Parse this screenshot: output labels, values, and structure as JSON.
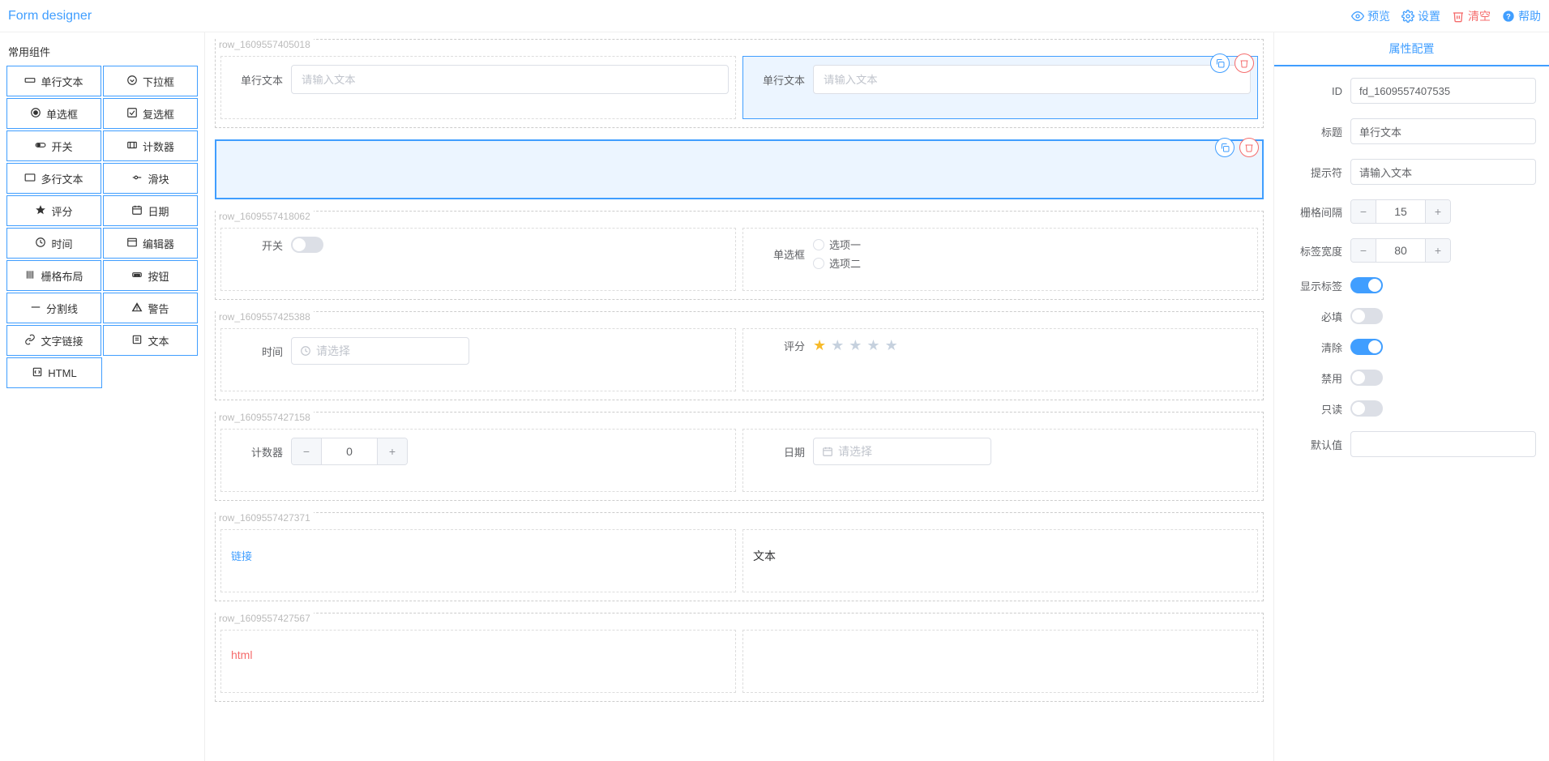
{
  "header": {
    "title": "Form designer",
    "actions": {
      "preview": "预览",
      "settings": "设置",
      "clear": "清空",
      "help": "帮助"
    }
  },
  "sidebar": {
    "title": "常用组件",
    "items": [
      {
        "key": "input",
        "label": "单行文本"
      },
      {
        "key": "select",
        "label": "下拉框"
      },
      {
        "key": "radio",
        "label": "单选框"
      },
      {
        "key": "checkbox",
        "label": "复选框"
      },
      {
        "key": "switch",
        "label": "开关"
      },
      {
        "key": "number",
        "label": "计数器"
      },
      {
        "key": "textarea",
        "label": "多行文本"
      },
      {
        "key": "slider",
        "label": "滑块"
      },
      {
        "key": "rate",
        "label": "评分"
      },
      {
        "key": "date",
        "label": "日期"
      },
      {
        "key": "time",
        "label": "时间"
      },
      {
        "key": "editor",
        "label": "编辑器"
      },
      {
        "key": "grid",
        "label": "栅格布局"
      },
      {
        "key": "button",
        "label": "按钮"
      },
      {
        "key": "divider",
        "label": "分割线"
      },
      {
        "key": "alert",
        "label": "警告"
      },
      {
        "key": "link",
        "label": "文字链接"
      },
      {
        "key": "text",
        "label": "文本"
      },
      {
        "key": "html",
        "label": "HTML"
      }
    ]
  },
  "canvas": {
    "rows": [
      {
        "id": "row_1609557405018",
        "cells": [
          {
            "type": "input",
            "label": "单行文本",
            "placeholder": "请输入文本"
          },
          {
            "type": "input",
            "label": "单行文本",
            "placeholder": "请输入文本",
            "selected": true
          }
        ]
      },
      {
        "id": "",
        "selected_row": true,
        "cells": []
      },
      {
        "id": "row_1609557418062",
        "cells": [
          {
            "type": "switch",
            "label": "开关",
            "value": false
          },
          {
            "type": "radio",
            "label": "单选框",
            "options": [
              "选项一",
              "选项二"
            ]
          }
        ]
      },
      {
        "id": "row_1609557425388",
        "cells": [
          {
            "type": "time",
            "label": "时间",
            "placeholder": "请选择"
          },
          {
            "type": "rate",
            "label": "评分",
            "value": 1,
            "max": 5
          }
        ]
      },
      {
        "id": "row_1609557427158",
        "cells": [
          {
            "type": "number",
            "label": "计数器",
            "value": "0"
          },
          {
            "type": "date",
            "label": "日期",
            "placeholder": "请选择"
          }
        ]
      },
      {
        "id": "row_1609557427371",
        "cells": [
          {
            "type": "link",
            "text": "链接"
          },
          {
            "type": "text",
            "text": "文本"
          }
        ]
      },
      {
        "id": "row_1609557427567",
        "cells": [
          {
            "type": "html",
            "text": "html"
          },
          {
            "type": "empty"
          }
        ]
      }
    ]
  },
  "props": {
    "tab": "属性配置",
    "id_label": "ID",
    "id_value": "fd_1609557407535",
    "title_label": "标题",
    "title_value": "单行文本",
    "placeholder_label": "提示符",
    "placeholder_value": "请输入文本",
    "gutter_label": "栅格间隔",
    "gutter_value": "15",
    "label_width_label": "标签宽度",
    "label_width_value": "80",
    "show_label_label": "显示标签",
    "show_label_on": true,
    "required_label": "必填",
    "required_on": false,
    "clearable_label": "清除",
    "clearable_on": true,
    "disabled_label": "禁用",
    "disabled_on": false,
    "readonly_label": "只读",
    "readonly_on": false,
    "default_label": "默认值",
    "default_value": ""
  }
}
